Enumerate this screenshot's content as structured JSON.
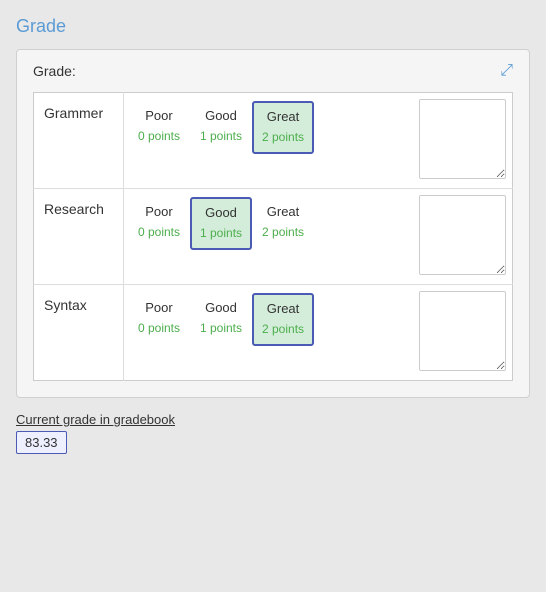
{
  "page": {
    "title": "Grade",
    "panel_label": "Grade:",
    "expand_icon": "⤢",
    "rows": [
      {
        "criterion": "Grammer",
        "ratings": [
          {
            "name": "Poor",
            "points": "0 points",
            "selected": false
          },
          {
            "name": "Good",
            "points": "1 points",
            "selected": false
          },
          {
            "name": "Great",
            "points": "2 points",
            "selected": true
          }
        ]
      },
      {
        "criterion": "Research",
        "ratings": [
          {
            "name": "Poor",
            "points": "0 points",
            "selected": false
          },
          {
            "name": "Good",
            "points": "1 points",
            "selected": true
          },
          {
            "name": "Great",
            "points": "2 points",
            "selected": false
          }
        ]
      },
      {
        "criterion": "Syntax",
        "ratings": [
          {
            "name": "Poor",
            "points": "0 points",
            "selected": false
          },
          {
            "name": "Good",
            "points": "1 points",
            "selected": false
          },
          {
            "name": "Great",
            "points": "2 points",
            "selected": true
          }
        ]
      }
    ],
    "current_grade_label": "Current grade in gradebook",
    "current_grade_value": "83.33"
  }
}
